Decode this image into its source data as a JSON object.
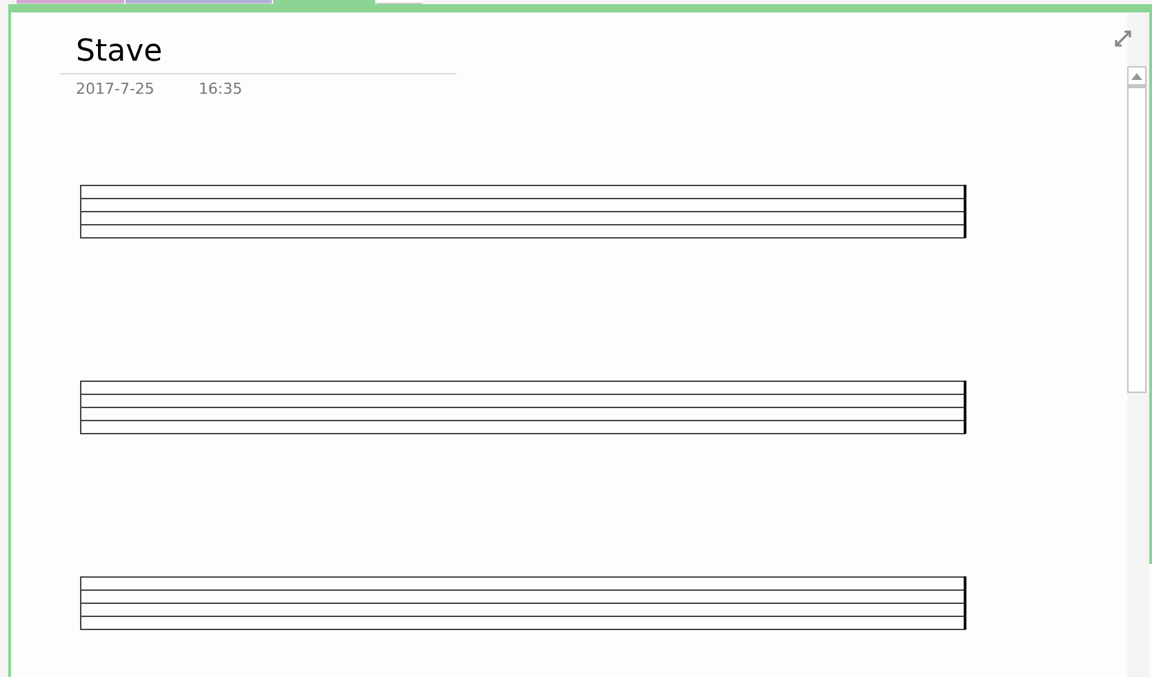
{
  "tabs": [
    {
      "selected": false,
      "color": "#d4a5cf"
    },
    {
      "selected": false,
      "color": "#b1afe0"
    },
    {
      "selected": true,
      "color": "#8cd493"
    },
    {
      "selected": false,
      "color": "#ffffff"
    }
  ],
  "page": {
    "title": "Stave",
    "date": "2017-7-25",
    "time": "16:35",
    "staves": [
      {
        "kind": "staff"
      },
      {
        "kind": "staff"
      },
      {
        "kind": "staff"
      }
    ]
  }
}
